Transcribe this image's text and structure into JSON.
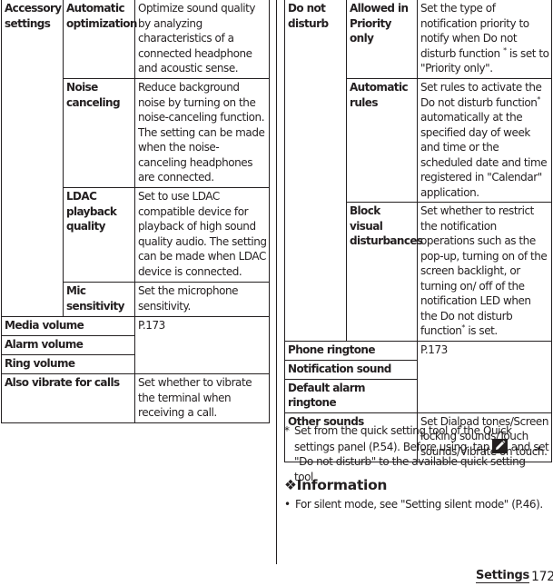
{
  "left_table": {
    "accessory": {
      "label": "Accessory settings",
      "rows": [
        {
          "name": "Automatic optimization",
          "desc": "Optimize sound quality by analyzing characteristics of a connected headphone and acoustic sense."
        },
        {
          "name": "Noise canceling",
          "desc": "Reduce background noise by turning on the noise-canceling function. The setting can be made when the noise-canceling headphones are connected."
        },
        {
          "name": "LDAC playback quality",
          "desc": "Set to use LDAC compatible device for playback of high sound quality audio. The setting can be made when LDAC device is connected."
        },
        {
          "name": "Mic sensitivity",
          "desc": "Set the microphone sensitivity."
        }
      ]
    },
    "volume_rows": [
      "Media volume",
      "Alarm volume",
      "Ring volume"
    ],
    "volume_ref": "P.173",
    "vibrate": {
      "name": "Also vibrate for calls",
      "desc": "Set whether to vibrate the terminal when receiving a call."
    }
  },
  "right_table": {
    "dnd": {
      "label": "Do not disturb",
      "rows": [
        {
          "name": "Allowed in Priority only",
          "desc_pre": "Set the type of notification priority to notify when Do not disturb function ",
          "desc_post": " is set to \"Priority only\"."
        },
        {
          "name": "Automatic rules",
          "desc_pre": "Set rules to activate the Do not disturb function",
          "desc_post": " automatically at the specified day of week and time or the scheduled date and time registered in \"Calendar\" application."
        },
        {
          "name": "Block visual disturbances",
          "desc_pre": "Set whether to restrict the notification operations such as the pop-up, turning on of the screen backlight, or turning on/ off of the notification LED when the Do not disturb function",
          "desc_post": " is set."
        }
      ]
    },
    "ringtone_rows": [
      "Phone ringtone",
      "Notification sound",
      "Default alarm ringtone"
    ],
    "ringtone_ref": "P.173",
    "other": {
      "name": "Other sounds",
      "desc": "Set Dialpad tones/Screen locking sounds/Touch sounds/Vibrate on touch."
    },
    "asterisk": "*"
  },
  "footnote": {
    "mark": "*",
    "text_pre": "Set from the quick setting tool of the Quick settings panel (P.54). Before using, tap ",
    "icon": "pencil-icon",
    "text_post": " and set \"Do not disturb\" to the available quick setting tool."
  },
  "information": {
    "title": "❖Information",
    "bullet": "•",
    "item": "For silent mode, see \"Setting silent mode\" (P.46)."
  },
  "footer": {
    "section": "Settings",
    "page": "172"
  }
}
